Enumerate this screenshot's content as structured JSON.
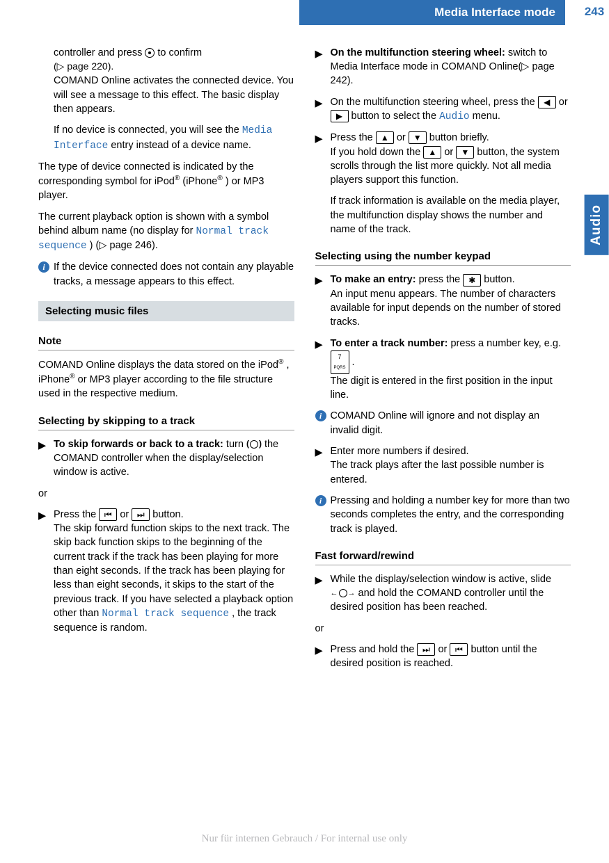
{
  "page": {
    "number": "243",
    "header": "Media Interface mode",
    "side_tab": "Audio"
  },
  "left": {
    "p1a": "controller and press ",
    "p1b": " to confirm",
    "p1_ref": "(▷ page 220).",
    "p2": "COMAND Online activates the connected device. You will see a message to this effect. The basic display then appears.",
    "p3a": "If no device is connected, you will see the ",
    "p3_code": "Media Interface",
    "p3b": " entry instead of a device name.",
    "p4a": "The type of device connected is indicated by the corresponding symbol for iPod",
    "p4b": " (iPhone",
    "p4c": ") or MP3 player.",
    "p5a": "The current playback option is shown with a symbol behind album name (no display for ",
    "p5_code": "Normal track sequence",
    "p5b": ") (▷ page 246).",
    "info1": "If the device connected does not contain any playable tracks, a message appears to this effect.",
    "section1": "Selecting music files",
    "note_head": "Note",
    "note_body_a": "COMAND Online displays the data stored on the iPod",
    "note_body_b": ", iPhone",
    "note_body_c": " or MP3 player according to the file structure used in the respective medium.",
    "sub1": "Selecting by skipping to a track",
    "skip_bold": "To skip forwards or back to a track:",
    "skip_text": " turn ",
    "skip_after": " the COMAND controller when the display/selection window is active.",
    "or": "or",
    "press_a": "Press the ",
    "press_or": " or ",
    "press_b": " button.",
    "press_body_a": "The skip forward function skips to the next track. The skip back function skips to the beginning of the current track if the track has been playing for more than eight seconds. If the track has been playing for less than eight seconds, it skips to the start of the previous track. If you have selected a playback option other than ",
    "press_code": "Normal track sequence",
    "press_body_b": ", the track sequence is random."
  },
  "right": {
    "mf_bold": "On the multifunction steering wheel:",
    "mf_text": " switch to Media Interface mode in COMAND Online(▷ page 242).",
    "mf2a": "On the multifunction steering wheel, press the ",
    "mf2_or": " or ",
    "mf2b": " button to select the ",
    "mf2_code": "Audio",
    "mf2c": " menu.",
    "mf3a": "Press the ",
    "mf3_or": " or ",
    "mf3b": " button briefly.",
    "mf3c": "If you hold down the ",
    "mf3_or2": " or ",
    "mf3d": " button, the system scrolls through the list more quickly. Not all media players support this function.",
    "mf4": "If track information is available on the media player, the multifunction display shows the number and name of the track.",
    "sub2": "Selecting using the number keypad",
    "entry_bold": "To make an entry:",
    "entry_a": " press the ",
    "entry_b": " button.",
    "entry_body": "An input menu appears. The number of characters available for input depends on the number of stored tracks.",
    "tracknum_bold": "To enter a track number:",
    "tracknum_a": " press a number key, e.g. ",
    "tracknum_b": ".",
    "tracknum_body": "The digit is entered in the first position in the input line.",
    "info2": "COMAND Online will ignore and not display an invalid digit.",
    "more_a": "Enter more numbers if desired.",
    "more_b": "The track plays after the last possible number is entered.",
    "info3": "Pressing and holding a number key for more than two seconds completes the entry, and the corresponding track is played.",
    "sub3": "Fast forward/rewind",
    "ff_a": "While the display/selection window is active, slide ",
    "ff_b": " and hold the COMAND controller until the desired position has been reached.",
    "or2": "or",
    "ff2a": "Press and hold the ",
    "ff2_or": " or ",
    "ff2b": " button until the desired position is reached."
  },
  "buttons": {
    "prev": "⏮",
    "next": "⏭",
    "left": "◀",
    "right": "▶",
    "up": "▲",
    "down": "▼",
    "star": "✱",
    "seven_top": "7",
    "seven_bot": "PQRS"
  },
  "footer": "Nur für internen Gebrauch / For internal use only"
}
